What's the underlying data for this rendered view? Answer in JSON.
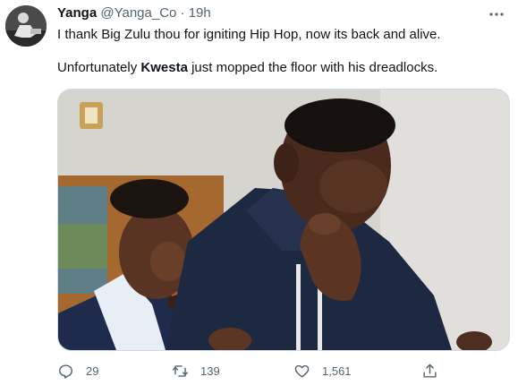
{
  "tweet": {
    "display_name": "Yanga",
    "handle": "@Yanga_Co",
    "separator": "·",
    "time": "19h",
    "line1": "I thank Big Zulu thou for igniting Hip Hop, now its back and alive.",
    "line2_before": "Unfortunately ",
    "line2_bold": "Kwesta",
    "line2_after": " just mopped the floor with his dreadlocks.",
    "more_icon": "more-horizontal-icon"
  },
  "actions": {
    "reply_count": "29",
    "retweet_count": "139",
    "like_count": "1,561",
    "reply_icon": "reply-icon",
    "retweet_icon": "retweet-icon",
    "like_icon": "heart-icon",
    "share_icon": "share-icon"
  },
  "colors": {
    "text_primary": "#0f1419",
    "text_secondary": "#536471",
    "border": "#cfd9de"
  }
}
